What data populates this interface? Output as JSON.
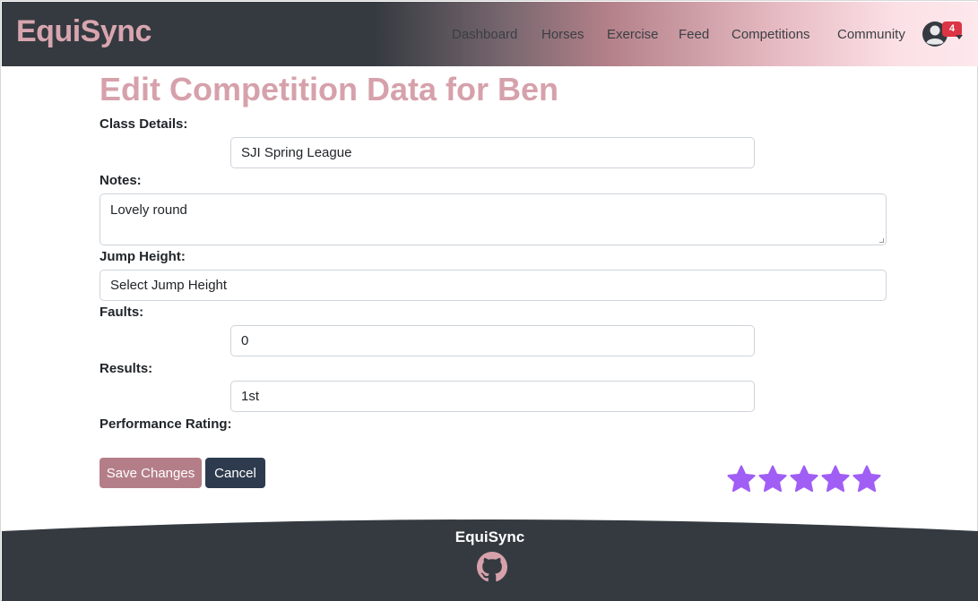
{
  "app": {
    "brand": "EquiSync"
  },
  "nav": {
    "items": [
      "Dashboard",
      "Horses",
      "Exercise",
      "Feed",
      "Competitions",
      "Community"
    ],
    "notification_count": "4"
  },
  "form": {
    "title": "Edit Competition Data for Ben",
    "class_details": {
      "label": "Class Details:",
      "value": "SJI Spring League"
    },
    "notes": {
      "label": "Notes:",
      "value": "Lovely round"
    },
    "jump_height": {
      "label": "Jump Height:",
      "value": "Select Jump Height"
    },
    "faults": {
      "label": "Faults:",
      "value": "0"
    },
    "results": {
      "label": "Results:",
      "value": "1st"
    },
    "performance_rating": {
      "label": "Performance Rating:",
      "stars": 5,
      "max": 5
    },
    "save_label": "Save Changes",
    "cancel_label": "Cancel"
  },
  "footer": {
    "title": "EquiSync",
    "icon": "github-icon"
  },
  "colors": {
    "brand_pink": "#d6a1ab",
    "save_button": "#b47e89",
    "cancel_button": "#2e3b4e",
    "star": "#a15ef5",
    "footer": "#343a40",
    "badge": "#dc3545"
  }
}
